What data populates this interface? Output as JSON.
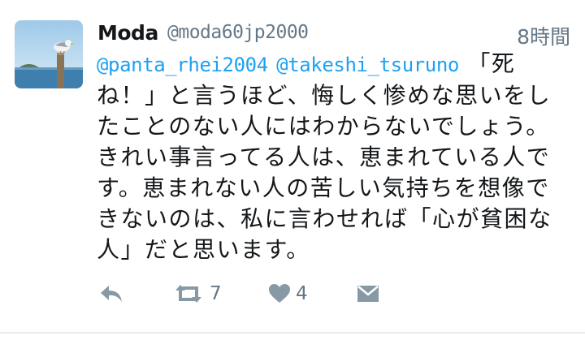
{
  "tweet": {
    "display_name": "Moda",
    "handle": "@moda60jp2000",
    "timestamp": "8時間",
    "mentions": [
      "@panta_rhei2004",
      "@takeshi_tsuruno"
    ],
    "text_lines": [
      "「死",
      "ね！」と言うほど、悔しく惨めな思いをし",
      "たことのない人にはわからないでしょう。",
      "きれい事言ってる人は、恵まれている人で",
      "す。恵まれない人の苦しい気持ちを想像で",
      "きないのは、私に言わせれば「心が貧困な",
      "人」だと思います。"
    ],
    "retweet_count": "7",
    "like_count": "4"
  },
  "icons": {
    "avatar": "seagull-on-post-photo",
    "reply": "reply-icon",
    "retweet": "retweet-icon",
    "like": "heart-icon",
    "dm": "envelope-icon"
  },
  "colors": {
    "mention": "#1da1f2",
    "secondary": "#657786",
    "icon": "#8899a6",
    "divider": "#e6ecf0"
  }
}
